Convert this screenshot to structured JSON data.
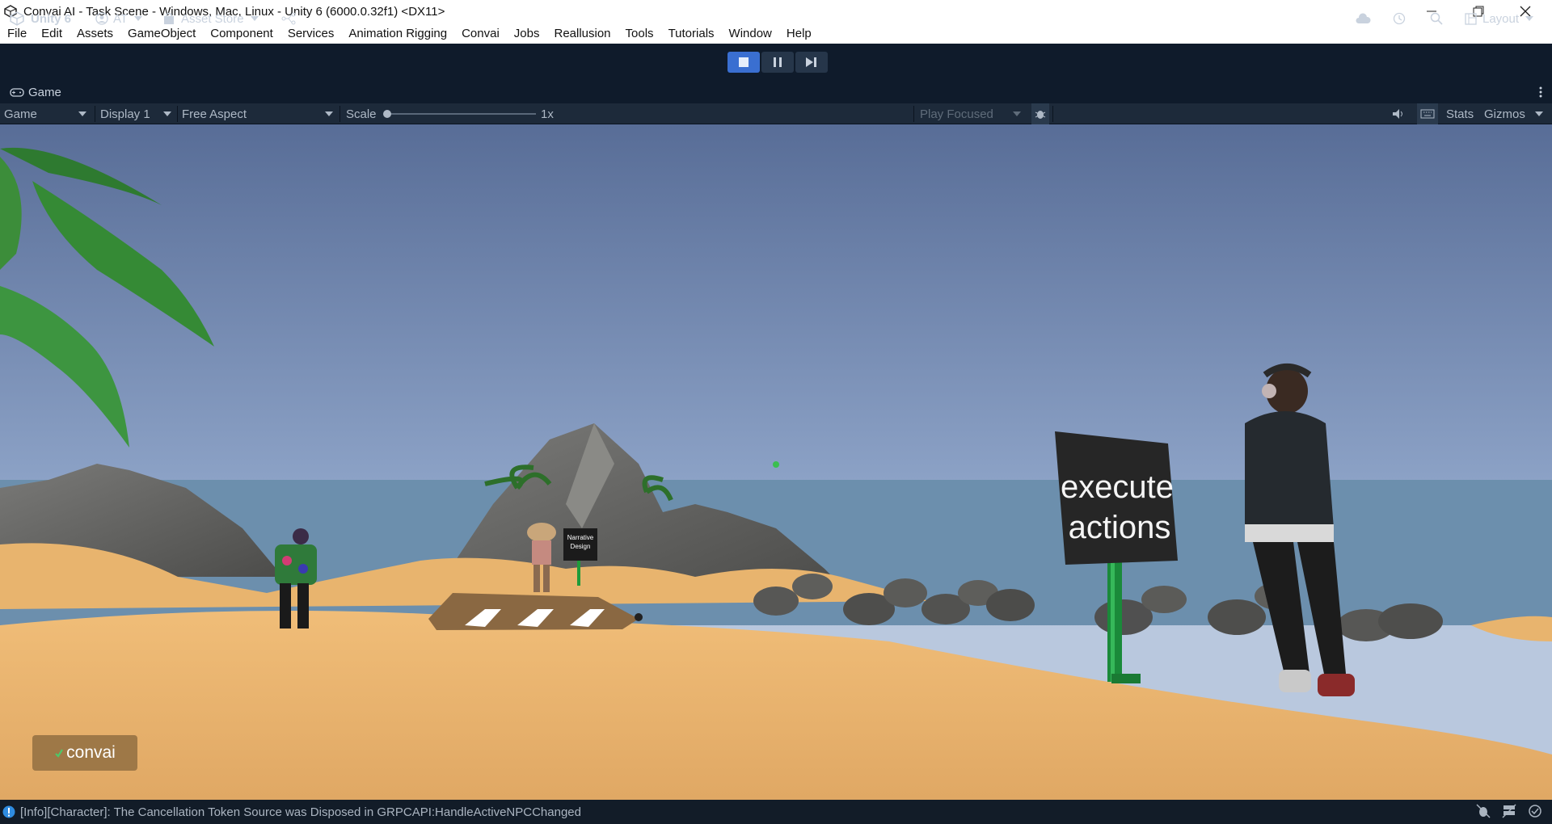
{
  "window": {
    "title": "Convai AI - Task Scene - Windows, Mac, Linux - Unity 6 (6000.0.32f1) <DX11>",
    "controls": [
      "minimize-icon",
      "restore-icon",
      "close-icon"
    ]
  },
  "menu": [
    "File",
    "Edit",
    "Assets",
    "GameObject",
    "Component",
    "Services",
    "Animation Rigging",
    "Convai",
    "Jobs",
    "Reallusion",
    "Tools",
    "Tutorials",
    "Window",
    "Help"
  ],
  "toolbar": {
    "unity_label": "Unity 6",
    "account_label": "AT",
    "asset_store_label": "Asset Store",
    "layout_label": "Layout"
  },
  "tab": {
    "label": "Game"
  },
  "game_toolbar": {
    "mode": "Game",
    "display": "Display 1",
    "aspect": "Free Aspect",
    "scale_label": "Scale",
    "scale_value": "1x",
    "play_focused": "Play Focused",
    "stats": "Stats",
    "gizmos": "Gizmos"
  },
  "scene": {
    "sign_text_line1": "execute",
    "sign_text_line2": "actions",
    "small_sign_line1": "Narrative",
    "small_sign_line2": "Design",
    "logo_text": "convai"
  },
  "status": {
    "message": "[Info][Character]: The Cancellation Token Source was Disposed in GRPCAPI:HandleActiveNPCChanged"
  },
  "colors": {
    "toolbar_bg": "#0f1b2b",
    "play_active": "#3a6fd1",
    "sky_top": "#5a6f9a",
    "sand": "#e8b46e"
  }
}
